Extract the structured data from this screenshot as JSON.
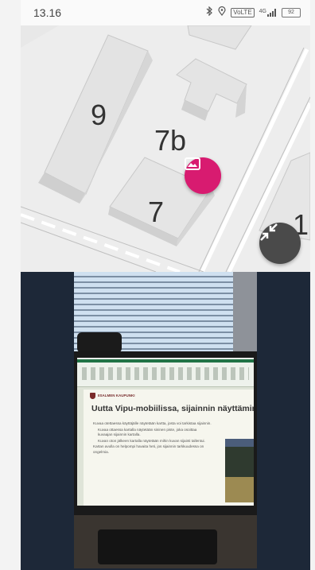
{
  "status_bar": {
    "time": "13.16",
    "icons": [
      "bluetooth-icon",
      "location-icon",
      "volte-icon",
      "signal-icon",
      "battery-icon"
    ],
    "volte": "VoLTE",
    "network": "4G",
    "battery": "92"
  },
  "map": {
    "building_labels": [
      "9",
      "7b",
      "7",
      "1"
    ],
    "photo_marker_icon": "image-icon",
    "collapse_icon": "collapse-arrows-icon",
    "colors": {
      "marker": "#d81b70",
      "collapse_button": "#4a4a4a"
    }
  },
  "photo": {
    "slide_org": "IISALMEN KAUPUNKI",
    "slide_title": "Uutta Vipu-mobiilissa, sijainnin näyttäminen",
    "slide_bullets": [
      "Kuvaa otettaessa käyttäjälle näytetään kartta, josta voi tarkistaa sijainnin.",
      "Kuvaa ottaessa kartalla näytetään sininen piste, joka osoittaa kuvaajan sijainnin kartalla.",
      "Kuvan oton jälkeen kartalla näytetään mihin kuvan sijainti tallentui.",
      "Kartan avulla on helpompi havaita heti, jos sijainnin tarkkuudessa on ongelmia."
    ],
    "background_color": "#1d2838"
  }
}
